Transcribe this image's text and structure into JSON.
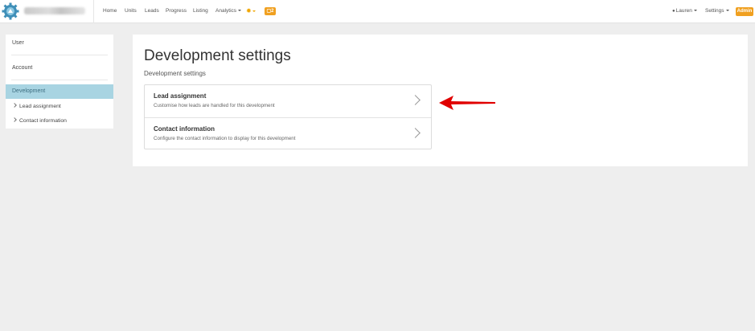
{
  "navbar": {
    "items": [
      {
        "label": "Home"
      },
      {
        "label": "Units"
      },
      {
        "label": "Leads"
      },
      {
        "label": "Progress"
      },
      {
        "label": "Listing"
      },
      {
        "label": "Analytics"
      }
    ],
    "notification_count": "2",
    "user_label": "Lauren",
    "settings_label": "Settings",
    "admin_badge": "Admin"
  },
  "sidebar": {
    "items": [
      {
        "label": "User"
      },
      {
        "label": "Account"
      },
      {
        "label": "Development"
      }
    ],
    "subitems": [
      {
        "label": "Lead assignment"
      },
      {
        "label": "Contact information"
      }
    ]
  },
  "main": {
    "title": "Development settings",
    "subtitle": "Development settings",
    "list": [
      {
        "title": "Lead assignment",
        "description": "Customise how leads are handled for this development"
      },
      {
        "title": "Contact information",
        "description": "Configure the contact information to display for this development"
      }
    ]
  },
  "colors": {
    "accent_orange": "#f0a020",
    "active_sidebar": "#a8d4e2",
    "annotation_red": "#e00000",
    "logo_blue": "#3f8fb8"
  }
}
